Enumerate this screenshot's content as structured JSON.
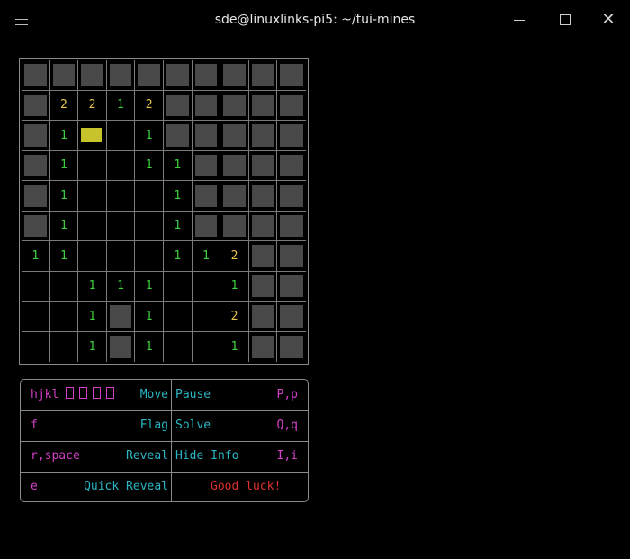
{
  "window": {
    "title": "sde@linuxlinks-pi5: ~/tui-mines",
    "close_glyph": "✕"
  },
  "board": {
    "cursor": {
      "row": 2,
      "col": 2
    },
    "rows": [
      [
        "#",
        "#",
        "#",
        "#",
        "#",
        "#",
        "#",
        "#",
        "#",
        "#"
      ],
      [
        "#",
        "2",
        "2",
        "1",
        "2",
        "#",
        "#",
        "#",
        "#",
        "#"
      ],
      [
        "#",
        "1",
        "",
        "",
        "1",
        "#",
        "#",
        "#",
        "#",
        "#"
      ],
      [
        "#",
        "1",
        "",
        "",
        "1",
        "1",
        "#",
        "#",
        "#",
        "#"
      ],
      [
        "#",
        "1",
        "",
        "",
        "",
        "1",
        "#",
        "#",
        "#",
        "#"
      ],
      [
        "#",
        "1",
        "",
        "",
        "",
        "1",
        "#",
        "#",
        "#",
        "#"
      ],
      [
        "1",
        "1",
        "",
        "",
        "",
        "1",
        "1",
        "2",
        "#",
        "#"
      ],
      [
        "",
        "",
        "1",
        "1",
        "1",
        "",
        "",
        "1",
        "#",
        "#"
      ],
      [
        "",
        "",
        "1",
        "#",
        "1",
        "",
        "",
        "2",
        "#",
        "#"
      ],
      [
        "",
        "",
        "1",
        "#",
        "1",
        "",
        "",
        "1",
        "#",
        "#"
      ]
    ]
  },
  "help": {
    "move_keys": "hjkl",
    "move_label": "Move",
    "flag_key": "f",
    "flag_label": "Flag",
    "reveal_key": "r,space",
    "reveal_label": "Reveal",
    "quick_key": "e",
    "quick_label": "Quick Reveal",
    "pause_label": "Pause",
    "pause_key": "P,p",
    "solve_label": "Solve",
    "solve_key": "Q,q",
    "info_label": "Hide Info",
    "info_key": "I,i",
    "message": "Good luck!"
  },
  "colors": {
    "number_1": "#3fcf3f",
    "number_2": "#e6c24a",
    "cursor": "#c6c42a",
    "key": "#d33fc7",
    "desc": "#2bb5c4",
    "message": "#e03030"
  }
}
